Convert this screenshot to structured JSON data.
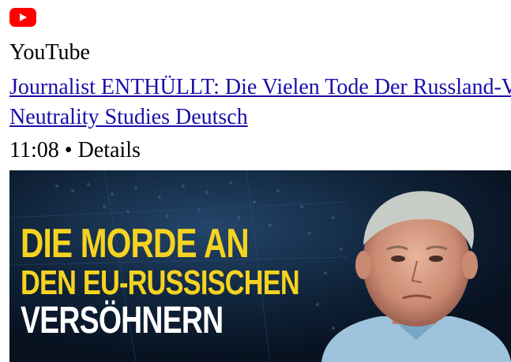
{
  "source": {
    "icon": "youtube-play-icon",
    "icon_color": "#ff0000",
    "name": "YouTube"
  },
  "video": {
    "title": "Journalist ENTHÜLLT: Die Vielen Tode Der Russland-Versöhner",
    "channel": "Neutrality Studies Deutsch",
    "duration": "11:08",
    "separator": "•",
    "details_label": "Details"
  },
  "thumbnail": {
    "line1": "DIE MORDE AN",
    "line2": "DEN EU-RUSSISCHEN",
    "line3": "VERSÖHNERN",
    "headline_color": "#f5d320",
    "background_color": "#0d1a2e"
  },
  "colors": {
    "link": "#1a0dab",
    "text": "#000000"
  }
}
